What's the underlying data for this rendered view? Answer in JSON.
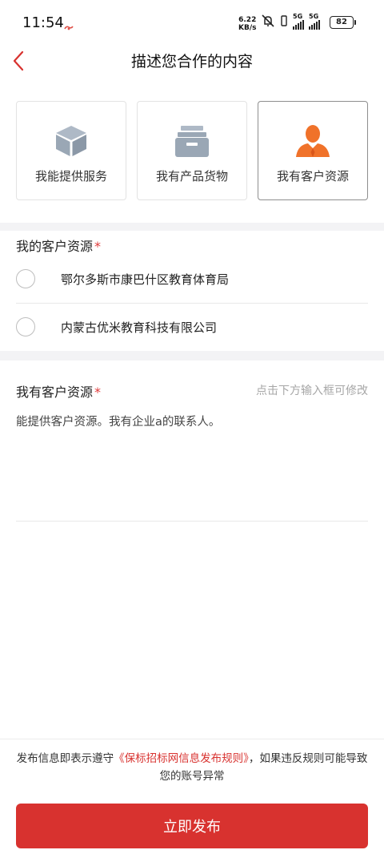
{
  "status": {
    "time": "11:54",
    "net_speed_value": "6.22",
    "net_speed_unit": "KB/s",
    "sig1_label": "5G",
    "sig2_label": "5G",
    "battery": "82"
  },
  "nav": {
    "title": "描述您合作的内容"
  },
  "cards": [
    {
      "label": "我能提供服务",
      "icon": "cube-icon",
      "selected": false
    },
    {
      "label": "我有产品货物",
      "icon": "archive-box-icon",
      "selected": false
    },
    {
      "label": "我有客户资源",
      "icon": "person-icon",
      "selected": true
    }
  ],
  "section1": {
    "title": "我的客户资源",
    "required_mark": "*",
    "options": [
      "鄂尔多斯市康巴什区教育体育局",
      "内蒙古优米教育科技有限公司"
    ]
  },
  "section2": {
    "title": "我有客户资源",
    "required_mark": "*",
    "hint": "点击下方输入框可修改",
    "content": "能提供客户资源。我有企业a的联系人。"
  },
  "footer": {
    "notice_prefix": "发布信息即表示遵守",
    "notice_link": "《保标招标网信息发布规则》",
    "notice_suffix": "，如果违反规则可能导致您的账号异常",
    "submit_label": "立即发布"
  },
  "colors": {
    "accent": "#d8322f",
    "icon_gray": "#9aa7b5",
    "icon_orange": "#f0722a"
  }
}
